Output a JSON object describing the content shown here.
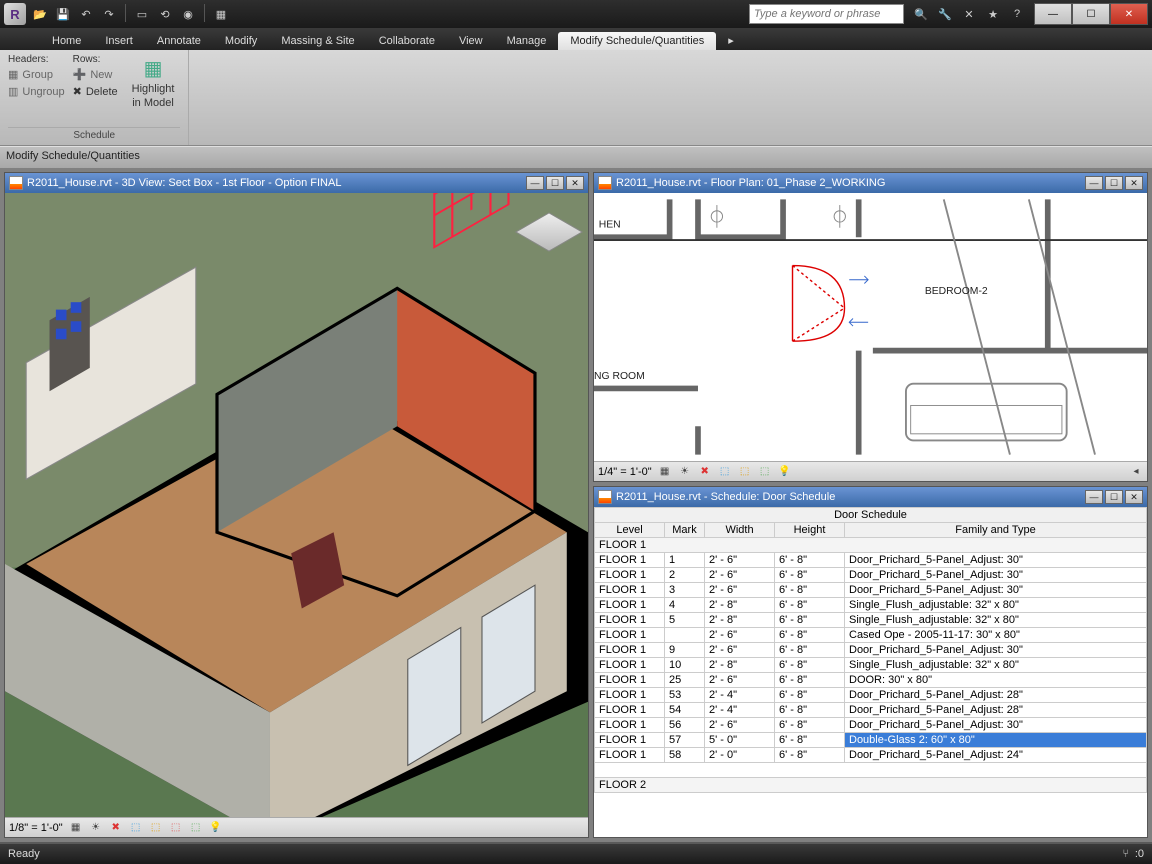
{
  "search": {
    "placeholder": "Type a keyword or phrase"
  },
  "menu": {
    "items": [
      "Home",
      "Insert",
      "Annotate",
      "Modify",
      "Massing & Site",
      "Collaborate",
      "View",
      "Manage",
      "Modify Schedule/Quantities"
    ],
    "active_index": 8
  },
  "ribbon": {
    "panel1": {
      "headers_label": "Headers:",
      "rows_label": "Rows:",
      "group": "Group",
      "ungroup": "Ungroup",
      "new": "New",
      "delete": "Delete",
      "highlight_line1": "Highlight",
      "highlight_line2": "in Model",
      "title": "Schedule"
    }
  },
  "path": "Modify Schedule/Quantities",
  "view1": {
    "title": "R2011_House.rvt - Floor Plan: 01_Phase 2_WORKING",
    "room1": "HEN",
    "room2": "BEDROOM-2",
    "room3": "NG ROOM",
    "scale": "1/4\" = 1'-0\""
  },
  "view2": {
    "title": "R2011_House.rvt - 3D View: Sect Box - 1st Floor - Option FINAL",
    "scale": "1/8\" = 1'-0\""
  },
  "view3": {
    "title": "R2011_House.rvt - Schedule: Door Schedule",
    "schedule_title": "Door Schedule",
    "headers": [
      "Level",
      "Mark",
      "Width",
      "Height",
      "Family and Type"
    ],
    "section1": "FLOOR 1",
    "section2": "FLOOR 2",
    "rows": [
      [
        "FLOOR 1",
        "1",
        "2' - 6\"",
        "6' - 8\"",
        "Door_Prichard_5-Panel_Adjust: 30\""
      ],
      [
        "FLOOR 1",
        "2",
        "2' - 6\"",
        "6' - 8\"",
        "Door_Prichard_5-Panel_Adjust: 30\""
      ],
      [
        "FLOOR 1",
        "3",
        "2' - 6\"",
        "6' - 8\"",
        "Door_Prichard_5-Panel_Adjust: 30\""
      ],
      [
        "FLOOR 1",
        "4",
        "2' - 8\"",
        "6' - 8\"",
        "Single_Flush_adjustable: 32\" x 80\""
      ],
      [
        "FLOOR 1",
        "5",
        "2' - 8\"",
        "6' - 8\"",
        "Single_Flush_adjustable: 32\" x 80\""
      ],
      [
        "FLOOR 1",
        "",
        "2' - 6\"",
        "6' - 8\"",
        "Cased Ope - 2005-11-17: 30\" x 80\""
      ],
      [
        "FLOOR 1",
        "9",
        "2' - 6\"",
        "6' - 8\"",
        "Door_Prichard_5-Panel_Adjust: 30\""
      ],
      [
        "FLOOR 1",
        "10",
        "2' - 8\"",
        "6' - 8\"",
        "Single_Flush_adjustable: 32\" x 80\""
      ],
      [
        "FLOOR 1",
        "25",
        "2' - 6\"",
        "6' - 8\"",
        "DOOR: 30\" x 80\""
      ],
      [
        "FLOOR 1",
        "53",
        "2' - 4\"",
        "6' - 8\"",
        "Door_Prichard_5-Panel_Adjust: 28\""
      ],
      [
        "FLOOR 1",
        "54",
        "2' - 4\"",
        "6' - 8\"",
        "Door_Prichard_5-Panel_Adjust: 28\""
      ],
      [
        "FLOOR 1",
        "56",
        "2' - 6\"",
        "6' - 8\"",
        "Door_Prichard_5-Panel_Adjust: 30\""
      ],
      [
        "FLOOR 1",
        "57",
        "5' - 0\"",
        "6' - 8\"",
        "Double-Glass 2: 60\" x 80\""
      ],
      [
        "FLOOR 1",
        "58",
        "2' - 0\"",
        "6' - 8\"",
        "Door_Prichard_5-Panel_Adjust: 24\""
      ]
    ],
    "selected_row_index": 12
  },
  "status": {
    "text": "Ready",
    "filter": "0"
  }
}
